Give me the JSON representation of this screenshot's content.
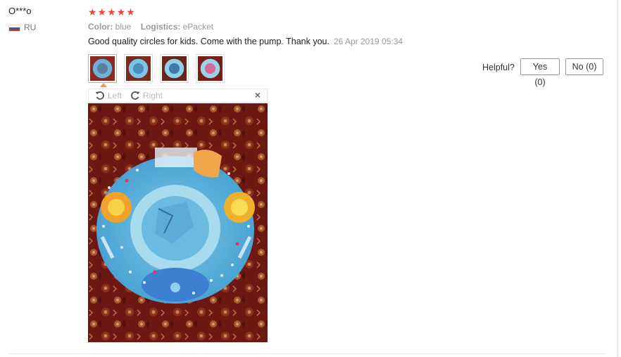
{
  "review": {
    "user": "O***o",
    "country": "RU",
    "rating_stars": "★★★★★",
    "rating": 5,
    "color_label": "Color:",
    "color_value": "blue",
    "logistics_label": "Logistics:",
    "logistics_value": "ePacket",
    "text": "Good quality circles for kids. Come with the pump. Thank you.",
    "date": "26 Apr 2019 05:34"
  },
  "viewer": {
    "rotate_left": "Left",
    "rotate_right": "Right",
    "close": "×"
  },
  "helpful": {
    "label": "Helpful?",
    "yes": "Yes (0)",
    "no": "No (0)"
  },
  "colors": {
    "star": "#f2443d",
    "thumb_active_border": "#f6a35e"
  }
}
